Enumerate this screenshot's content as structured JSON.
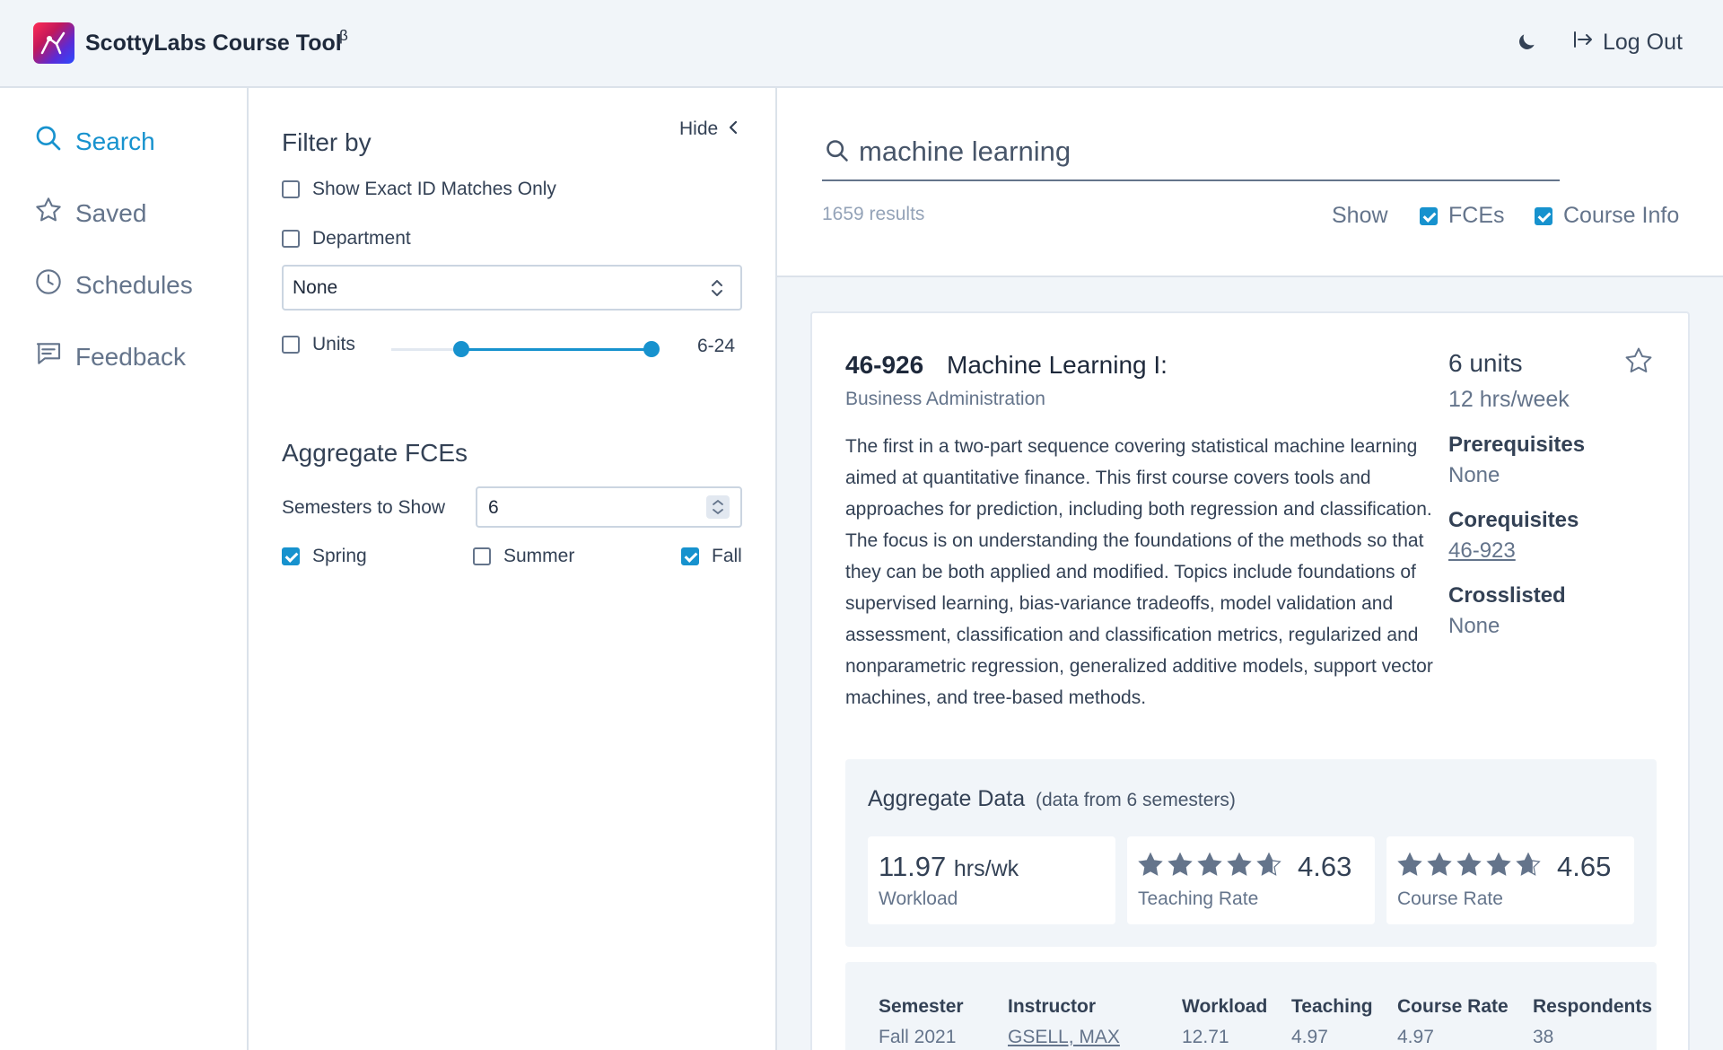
{
  "header": {
    "title": "ScottyLabs Course Tool",
    "beta": "β",
    "logout_label": "Log Out",
    "theme_icon": "moon-icon"
  },
  "nav": {
    "items": [
      {
        "label": "Search",
        "icon": "search-icon"
      },
      {
        "label": "Saved",
        "icon": "star-icon"
      },
      {
        "label": "Schedules",
        "icon": "clock-icon"
      },
      {
        "label": "Feedback",
        "icon": "feedback-icon"
      }
    ]
  },
  "filters": {
    "title": "Filter by",
    "hide_label": "Hide",
    "exact_id_label": "Show Exact ID Matches Only",
    "department_label": "Department",
    "department_value": "None",
    "units_label": "Units",
    "units_range": "6-24",
    "aggregate_title": "Aggregate FCEs",
    "semesters_label": "Semesters to Show",
    "semesters_value": "6",
    "spring_label": "Spring",
    "summer_label": "Summer",
    "fall_label": "Fall"
  },
  "search": {
    "query": "machine learning",
    "results": "1659 results",
    "show_label": "Show",
    "fces_label": "FCEs",
    "course_info_label": "Course Info"
  },
  "course": {
    "id": "46-926",
    "name": "Machine Learning I:",
    "department": "Business Administration",
    "description": "The first in a two-part sequence covering statistical machine learning aimed at quantitative finance. This first course covers tools and approaches for prediction, including both regression and classification. The focus is on understanding the foundations of the methods so that they can be both applied and modified. Topics include foundations of supervised learning, bias-variance tradeoffs, model validation and assessment, classification and classification metrics, regularized and nonparametric regression, generalized additive models, support vector machines, and tree-based methods.",
    "units": "6 units",
    "hours": "12 hrs/week",
    "prereq_title": "Prerequisites",
    "prereq_value": "None",
    "coreq_title": "Corequisites",
    "coreq_value": "46-923",
    "cross_title": "Crosslisted",
    "cross_value": "None"
  },
  "aggregate": {
    "title": "Aggregate Data",
    "subtitle": "(data from 6 semesters)",
    "workload_value": "11.97",
    "workload_unit": "hrs/wk",
    "workload_label": "Workload",
    "teaching_value": "4.63",
    "teaching_label": "Teaching Rate",
    "course_value": "4.65",
    "course_label": "Course Rate",
    "teaching_rating": 4.63,
    "course_rating": 4.65
  },
  "fce_table": {
    "headers": [
      "Semester",
      "Instructor",
      "Workload",
      "Teaching",
      "Course Rate",
      "Respondents"
    ],
    "rows": [
      [
        "Fall 2021",
        "GSELL, MAX",
        "12.71",
        "4.97",
        "4.97",
        "38"
      ]
    ]
  },
  "colors": {
    "accent": "#1792ce",
    "text": "#334155",
    "muted": "#64748b",
    "bg": "#f1f5f9"
  }
}
